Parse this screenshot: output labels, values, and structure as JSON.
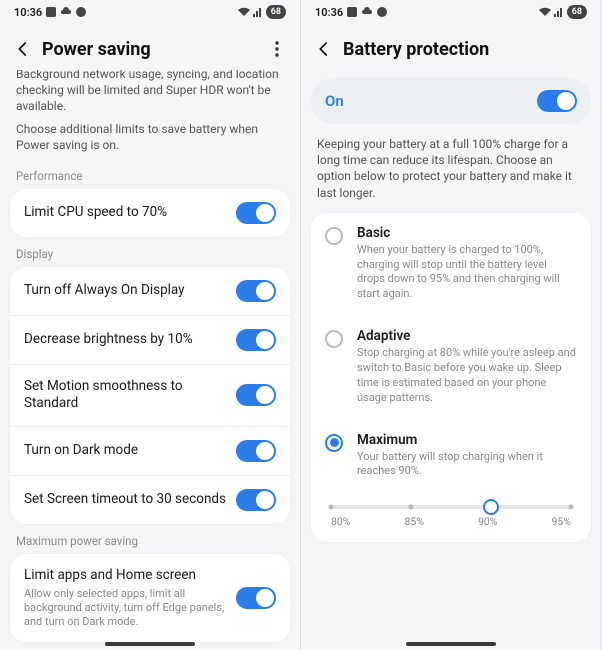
{
  "statusbar": {
    "time": "10:36",
    "battery": "68"
  },
  "left": {
    "title": "Power saving",
    "desc_cut": "Background network usage, syncing, and location checking will be limited and Super HDR won't be available.",
    "desc2": "Choose additional limits to save battery when Power saving is on.",
    "section_perf": "Performance",
    "cpu": "Limit CPU speed to 70%",
    "section_display": "Display",
    "aod": "Turn off Always On Display",
    "brightness": "Decrease brightness by 10%",
    "motion": "Set Motion smoothness to Standard",
    "dark": "Turn on Dark mode",
    "timeout": "Set Screen timeout to 30 seconds",
    "section_max": "Maximum power saving",
    "limit_apps": "Limit apps and Home screen",
    "limit_apps_sub": "Allow only selected apps, limit all background activity, turn off Edge panels, and turn on Dark mode."
  },
  "right": {
    "title": "Battery protection",
    "on": "On",
    "desc": "Keeping your battery at a full 100% charge for a long time can reduce its lifespan. Choose an option below to protect your battery and make it last longer.",
    "basic_t": "Basic",
    "basic_d": "When your battery is charged to 100%, charging will stop until the battery level drops down to 95% and then charging will start again.",
    "adaptive_t": "Adaptive",
    "adaptive_d": "Stop charging at 80% while you're asleep and switch to Basic before you wake up. Sleep time is estimated based on your phone usage patterns.",
    "max_t": "Maximum",
    "max_d": "Your battery will stop charging when it reaches 90%.",
    "slider": {
      "t0": "80%",
      "t1": "85%",
      "t2": "90%",
      "t3": "95%"
    }
  }
}
